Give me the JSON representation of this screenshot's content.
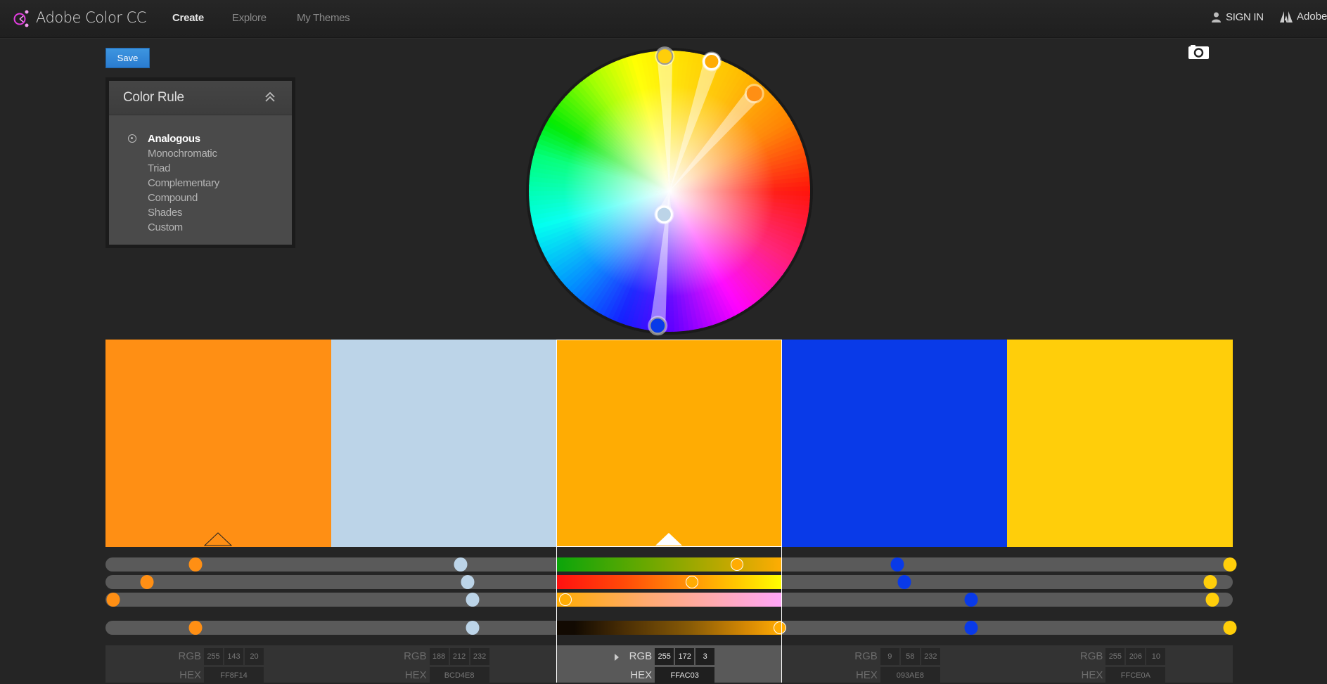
{
  "header": {
    "app_title": "Adobe Color CC",
    "nav": [
      {
        "label": "Create",
        "active": true
      },
      {
        "label": "Explore",
        "active": false
      },
      {
        "label": "My Themes",
        "active": false
      }
    ],
    "sign_in": "SIGN IN",
    "adobe_link": "Adobe",
    "logo_color": "#e33ce0"
  },
  "toolbar": {
    "save_label": "Save"
  },
  "color_rule": {
    "title": "Color Rule",
    "selected": "Analogous",
    "options": [
      "Analogous",
      "Monochromatic",
      "Triad",
      "Complementary",
      "Compound",
      "Shades",
      "Custom"
    ]
  },
  "theme": {
    "selected_index": 2,
    "base_index": 0,
    "swatches": [
      {
        "hex": "#FF8F14",
        "hex_label": "FF8F14",
        "rgb": [
          "255",
          "143",
          "20"
        ]
      },
      {
        "hex": "#BCD4E8",
        "hex_label": "BCD4E8",
        "rgb": [
          "188",
          "212",
          "232"
        ]
      },
      {
        "hex": "#FFAC03",
        "hex_label": "FFAC03",
        "rgb": [
          "255",
          "172",
          "3"
        ]
      },
      {
        "hex": "#093AE8",
        "hex_label": "093AE8",
        "rgb": [
          "9",
          "58",
          "232"
        ]
      },
      {
        "hex": "#FFCE0A",
        "hex_label": "FFCE0A",
        "rgb": [
          "255",
          "206",
          "10"
        ]
      }
    ],
    "sliders": [
      {
        "name": "hue",
        "values": [
          0.4,
          0.575,
          0.8,
          0.512,
          0.987
        ]
      },
      {
        "name": "saturation",
        "values": [
          0.185,
          0.605,
          0.6,
          0.542,
          0.9
        ]
      },
      {
        "name": "brightness",
        "values": [
          0.035,
          0.627,
          0.04,
          0.84,
          0.91
        ]
      },
      {
        "name": "value",
        "values": [
          0.4,
          0.627,
          0.99,
          0.84,
          0.987
        ]
      }
    ]
  },
  "values_panel": {
    "rgb_label": "RGB",
    "hex_label": "HEX"
  },
  "wheel": {
    "handles": [
      {
        "color": "#FF8F14",
        "angle_deg": 41,
        "radius_frac": 0.92,
        "ring": "none"
      },
      {
        "color": "#BCD4E8",
        "angle_deg": 193,
        "radius_frac": 0.17,
        "ring": "white"
      },
      {
        "color": "#FFAC03",
        "angle_deg": 18,
        "radius_frac": 0.97,
        "ring": "white"
      },
      {
        "color": "#093AE8",
        "angle_deg": 185,
        "radius_frac": 0.96,
        "ring": "gray"
      },
      {
        "color": "#FFCE0A",
        "angle_deg": 358,
        "radius_frac": 0.96,
        "ring": "gray"
      }
    ]
  }
}
